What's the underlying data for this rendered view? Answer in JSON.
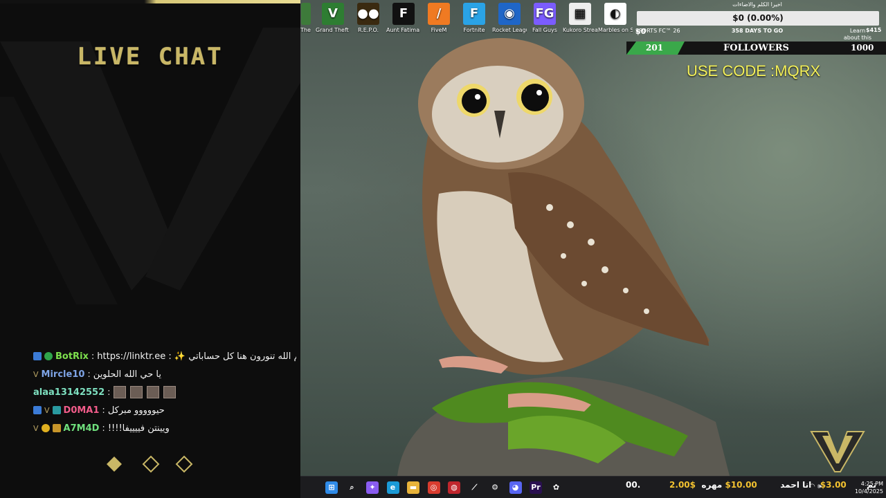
{
  "chat": {
    "title": "LIVE CHAT",
    "messages": [
      {
        "user": "BotRix",
        "user_color": "#7de04d",
        "text": "حياكم الله تنورون هنا كل حساباتي ✨ : https://linktr.ee",
        "badges": [
          "blue",
          "green"
        ]
      },
      {
        "user": "Mircle10",
        "user_color": "#7ea4e6",
        "text": "يا حي الله الحلوين",
        "badges": [
          "v"
        ]
      },
      {
        "user": "alaa13142552",
        "user_color": "#7ee0c0",
        "text": "",
        "emotes": 4,
        "badges": []
      },
      {
        "user": "D0MA1",
        "user_color": "#f25c8a",
        "text": "حيووووو مبركل",
        "badges": [
          "blue",
          "v",
          "teal"
        ]
      },
      {
        "user": "A7M4D",
        "user_color": "#6fe07d",
        "text": "ويينتن فييييفا!!!!",
        "badges": [
          "v",
          "yellow",
          "gold"
        ]
      }
    ],
    "separator": ":"
  },
  "desktop": {
    "icons": [
      {
        "name": "grand-theft-auto-icon",
        "label": "Grand Theft Auto V Le...",
        "glyph": "V",
        "color": "#2e7d32"
      },
      {
        "name": "repo-icon",
        "label": "R.E.P.O.",
        "glyph": "●●",
        "color": "#3a2a10"
      },
      {
        "name": "aunt-fatima-icon",
        "label": "Aunt Fatima خالة فاطمة",
        "glyph": "F",
        "color": "#111111"
      },
      {
        "name": "fivem-icon",
        "label": "FiveM",
        "glyph": "/",
        "color": "#f07a22"
      },
      {
        "name": "fortnite-icon",
        "label": "Fortnite",
        "glyph": "F",
        "color": "#2aa3e6"
      },
      {
        "name": "rocket-league-icon",
        "label": "Rocket League ®",
        "glyph": "◉",
        "color": "#1f66c7"
      },
      {
        "name": "fall-guys-icon",
        "label": "Fall Guys",
        "glyph": "FG",
        "color": "#7b5cff"
      },
      {
        "name": "kukoro-icon",
        "label": "Kukoro Stream ch...",
        "glyph": "▦",
        "color": "#eeeeee"
      },
      {
        "name": "marbles-icon",
        "label": "Marbles on Stream",
        "glyph": "◐",
        "color": "#ffffff"
      }
    ],
    "partial_icon_label": "The s",
    "sports_label": "SPORTS FC™ 26",
    "learn_more": "Learn about this picture",
    "code_text": "USE CODE :MQRX"
  },
  "goal": {
    "title": "اخيرا الكلم والاضاءات",
    "amount": "$0 (0.00%)",
    "days": "358 DAYS TO GO",
    "left_value": "$0",
    "right_value": "$415",
    "progress": 0.0
  },
  "followers": {
    "current": "201",
    "label": "FOLLOWERS",
    "goal": "1000",
    "progress": 0.201,
    "color": "#3aa84a"
  },
  "taskbar": {
    "ticker": [
      "00.",
      "2.00$",
      "تم",
      "3.00$",
      "انا احمد",
      "10.00$",
      "مهره"
    ],
    "time": "4:25 PM",
    "date": "10/4/2025",
    "icons": [
      {
        "name": "windows-start-icon",
        "glyph": "⊞",
        "color": "#2f8be8"
      },
      {
        "name": "search-icon",
        "glyph": "⌕",
        "color": "transparent"
      },
      {
        "name": "copilot-icon",
        "glyph": "✦",
        "color": "#8a5cf0"
      },
      {
        "name": "edge-icon",
        "glyph": "e",
        "color": "#1b9ad6"
      },
      {
        "name": "file-explorer-icon",
        "glyph": "▬",
        "color": "#e8b33a"
      },
      {
        "name": "chrome-icon",
        "glyph": "◎",
        "color": "#d93c2f"
      },
      {
        "name": "app-red-icon",
        "glyph": "◍",
        "color": "#c0262d"
      },
      {
        "name": "app-arrow-icon",
        "glyph": "⟋",
        "color": "transparent"
      },
      {
        "name": "settings-icon",
        "glyph": "⚙",
        "color": "transparent"
      },
      {
        "name": "discord-icon",
        "glyph": "◕",
        "color": "#5865f2"
      },
      {
        "name": "premiere-icon",
        "glyph": "Pr",
        "color": "#2a1050"
      },
      {
        "name": "app-bee-icon",
        "glyph": "✿",
        "color": "transparent"
      }
    ]
  },
  "colors": {
    "accent_gold": "#c9b766",
    "code_yellow": "#f4f15a"
  }
}
